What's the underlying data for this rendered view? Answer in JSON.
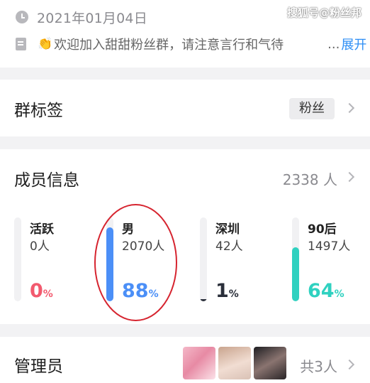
{
  "header": {
    "date": "2021年01月04日",
    "watermark": "搜狐号@粉丝邦",
    "notice_emoji": "👏",
    "notice_text": "欢迎加入甜甜粉丝群，请注意言行和气待",
    "notice_ellipsis": "...",
    "expand_label": "展开",
    "icons": {
      "date": "clock-icon",
      "notice": "document-icon"
    }
  },
  "group_tags": {
    "title": "群标签",
    "tag": "粉丝"
  },
  "members": {
    "title": "成员信息",
    "total": "2338 人",
    "stats": [
      {
        "label": "活跃",
        "value": "0人",
        "percent": "0",
        "fraction": 0.0,
        "color": "#f25a6e"
      },
      {
        "label": "男",
        "value": "2070人",
        "percent": "88",
        "fraction": 0.88,
        "color": "#4b8ff7"
      },
      {
        "label": "深圳",
        "value": "42人",
        "percent": "1",
        "fraction": 0.01,
        "color": "#2a2f3a"
      },
      {
        "label": "90后",
        "value": "1497人",
        "percent": "64",
        "fraction": 0.64,
        "color": "#2fd1c0"
      }
    ],
    "percent_sign": "%",
    "highlight_color": "#d6242f"
  },
  "admins": {
    "title": "管理员",
    "count": "共3人"
  }
}
